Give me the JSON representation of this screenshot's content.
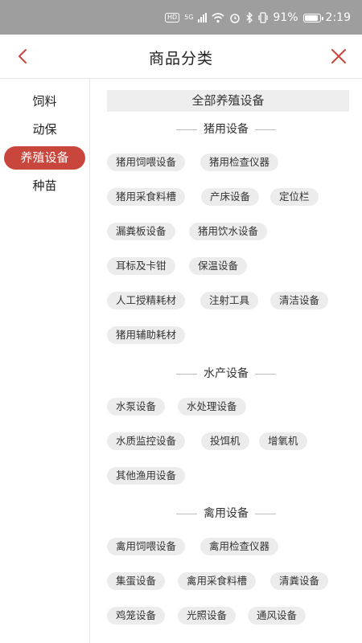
{
  "status_bar": {
    "hd": "HD",
    "network": "5G",
    "battery": "91%",
    "time": "2:19"
  },
  "header": {
    "title": "商品分类"
  },
  "sidebar": {
    "items": [
      {
        "label": "饲料",
        "active": false
      },
      {
        "label": "动保",
        "active": false
      },
      {
        "label": "养殖设备",
        "active": true
      },
      {
        "label": "种苗",
        "active": false
      }
    ]
  },
  "content": {
    "all_label": "全部养殖设备",
    "sections": [
      {
        "title": "猪用设备",
        "tags": [
          "猪用饲喂设备",
          "猪用检查仪器",
          "猪用采食料槽",
          "产床设备",
          "定位栏",
          "漏粪板设备",
          "猪用饮水设备",
          "耳标及卡钳",
          "保温设备",
          "人工授精耗材",
          "注射工具",
          "清洁设备",
          "猪用辅助耗材"
        ]
      },
      {
        "title": "水产设备",
        "tags": [
          "水泵设备",
          "水处理设备",
          "水质监控设备",
          "投饵机",
          "增氧机",
          "其他渔用设备"
        ]
      },
      {
        "title": "禽用设备",
        "tags": [
          "禽用饲喂设备",
          "禽用检查仪器",
          "集蛋设备",
          "禽用采食料槽",
          "清粪设备",
          "鸡笼设备",
          "光照设备",
          "通风设备"
        ]
      }
    ]
  }
}
